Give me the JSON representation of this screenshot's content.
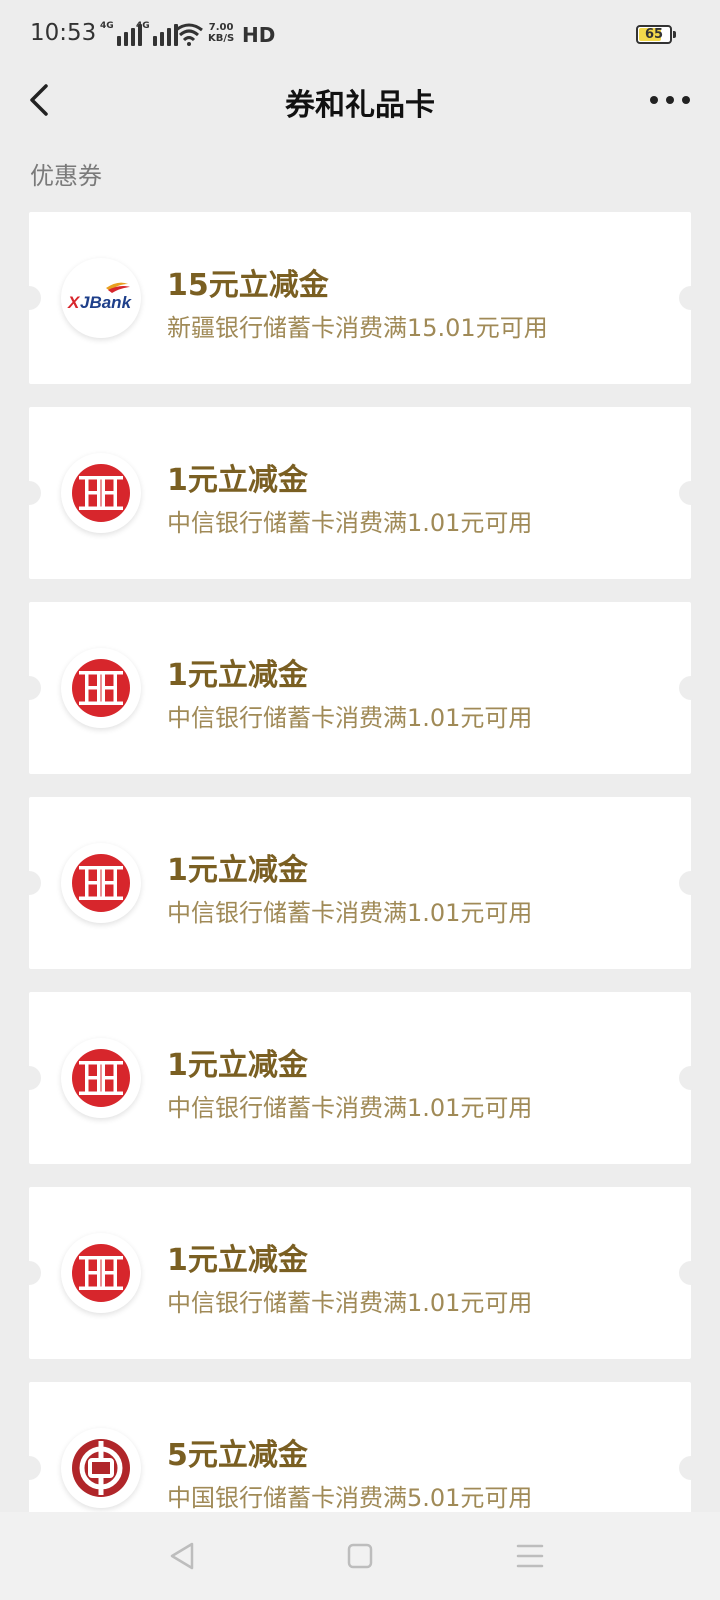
{
  "status_bar": {
    "time": "10:53",
    "network1": "4G",
    "network2": "4G",
    "speed_value": "7.00",
    "speed_unit": "KB/S",
    "hd": "HD",
    "battery": "65"
  },
  "nav": {
    "title": "券和礼品卡",
    "back_icon": "chevron-left-icon",
    "more_icon": "more-dots-icon"
  },
  "section": {
    "label": "优惠券"
  },
  "coupons": [
    {
      "title": "15元立减金",
      "desc": "新疆银行储蓄卡消费满15.01元可用",
      "bank_logo": "xjbank-logo",
      "logo_text": "XJBank"
    },
    {
      "title": "1元立减金",
      "desc": "中信银行储蓄卡消费满1.01元可用",
      "bank_logo": "citic-logo"
    },
    {
      "title": "1元立减金",
      "desc": "中信银行储蓄卡消费满1.01元可用",
      "bank_logo": "citic-logo"
    },
    {
      "title": "1元立减金",
      "desc": "中信银行储蓄卡消费满1.01元可用",
      "bank_logo": "citic-logo"
    },
    {
      "title": "1元立减金",
      "desc": "中信银行储蓄卡消费满1.01元可用",
      "bank_logo": "citic-logo"
    },
    {
      "title": "1元立减金",
      "desc": "中信银行储蓄卡消费满1.01元可用",
      "bank_logo": "citic-logo"
    },
    {
      "title": "5元立减金",
      "desc": "中国银行储蓄卡消费满5.01元可用",
      "bank_logo": "boc-logo"
    }
  ],
  "colors": {
    "background": "#ededed",
    "coupon_title": "#7a5f22",
    "coupon_desc": "#a08a57",
    "citic_red": "#d7262c",
    "boc_red": "#b0262a"
  },
  "system_nav": {
    "back_icon": "triangle-back-icon",
    "home_icon": "square-home-icon",
    "menu_icon": "menu-lines-icon"
  }
}
